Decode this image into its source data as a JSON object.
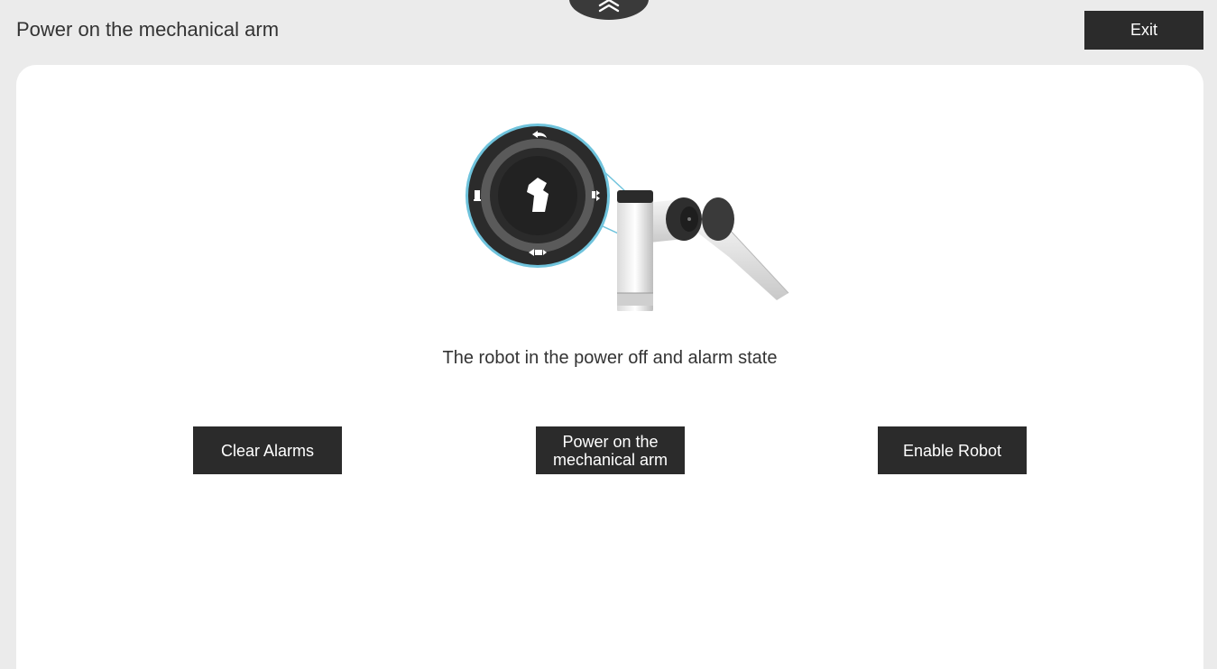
{
  "header": {
    "title": "Power on the mechanical arm",
    "exit_label": "Exit",
    "pull_tab_icon": "double-chevron-up-icon"
  },
  "main": {
    "status_text": "The robot in the power off and alarm state",
    "illustration_icon": "robot-arm-control-panel-illustration",
    "buttons": {
      "clear_alarms": "Clear Alarms",
      "power_on_line1": "Power on the",
      "power_on_line2": "mechanical arm",
      "enable_robot": "Enable Robot"
    }
  },
  "colors": {
    "background": "#ebebeb",
    "card": "#ffffff",
    "button": "#2b2b2b",
    "button_text": "#ffffff",
    "ring_accent": "#6fc3dc"
  }
}
